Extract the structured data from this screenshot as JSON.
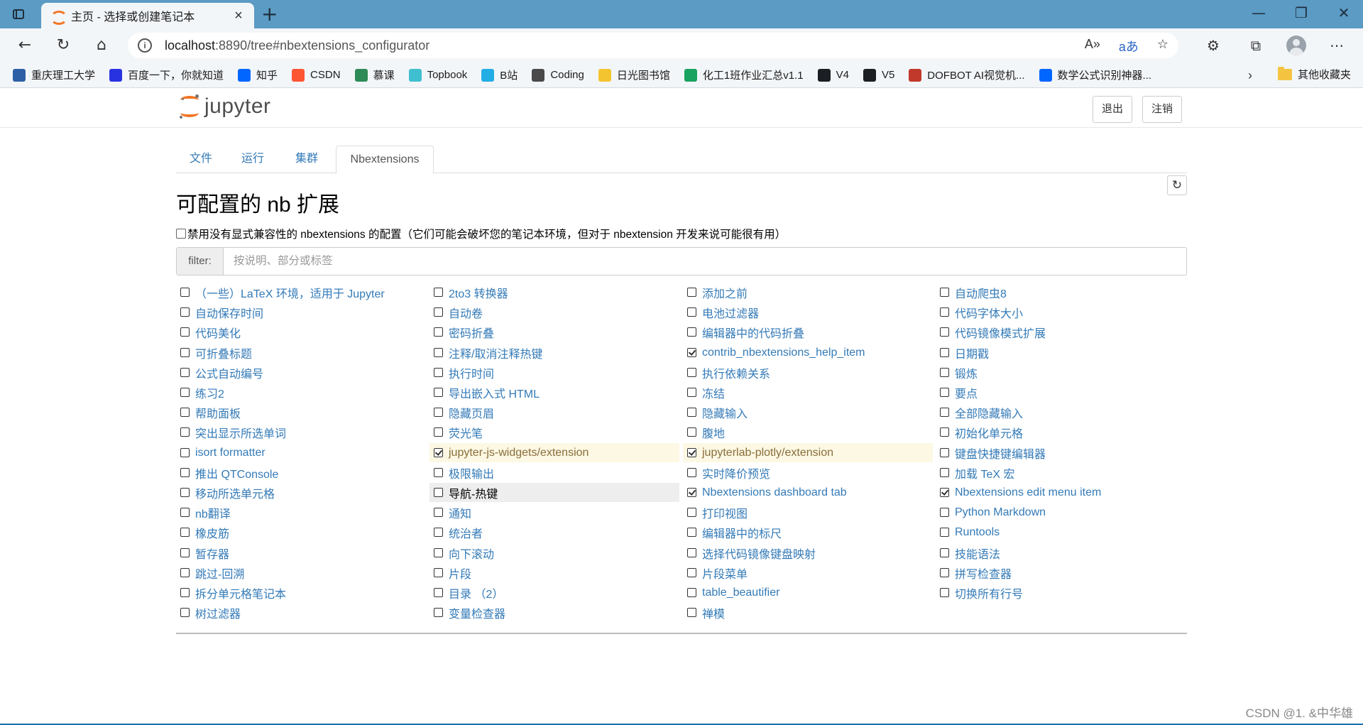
{
  "browser": {
    "tab_title": "主页 - 选择或创建笔记本",
    "url_host": "localhost",
    "url_rest": ":8890/tree#nbextensions_configurator",
    "bookmarks": [
      {
        "label": "重庆理工大学",
        "icon": "globe-icon",
        "color": "#2d5fa6"
      },
      {
        "label": "百度一下，你就知道",
        "icon": "baidu-paw-icon",
        "color": "#2932e1"
      },
      {
        "label": "知乎",
        "icon": "zhihu-icon",
        "color": "#0066ff"
      },
      {
        "label": "CSDN",
        "icon": "csdn-icon",
        "color": "#fc5531"
      },
      {
        "label": "慕课",
        "icon": "mooc-icon",
        "color": "#2e8b57"
      },
      {
        "label": "Topbook",
        "icon": "topbook-icon",
        "color": "#3fbfd0"
      },
      {
        "label": "B站",
        "icon": "bilibili-icon",
        "color": "#23ade5"
      },
      {
        "label": "Coding",
        "icon": "coding-icon",
        "color": "#4a4a4a"
      },
      {
        "label": "日光图书馆",
        "icon": "sun-icon",
        "color": "#f4c430"
      },
      {
        "label": "化工1班作业汇总v1.1",
        "icon": "sheet-icon",
        "color": "#1aa260"
      },
      {
        "label": "V4",
        "icon": "github-icon",
        "color": "#1b1f23"
      },
      {
        "label": "V5",
        "icon": "github-icon",
        "color": "#1b1f23"
      },
      {
        "label": "DOFBOT AI视觉机...",
        "icon": "robot-icon",
        "color": "#c0392b"
      },
      {
        "label": "数学公式识别神器...",
        "icon": "zhihu-icon",
        "color": "#0066ff"
      }
    ],
    "other_bookmarks": "其他收藏夹"
  },
  "header": {
    "logo_text": "jupyter",
    "quit_label": "退出",
    "logout_label": "注销"
  },
  "tabs": [
    "文件",
    "运行",
    "集群",
    "Nbextensions"
  ],
  "page": {
    "title": "可配置的 nb 扩展",
    "compat_label": "禁用没有显式兼容性的 nbextensions 的配置（它们可能会破坏您的笔记本环境，但对于 nbextension 开发来说可能很有用）",
    "filter_label": "filter:",
    "filter_placeholder": "按说明、部分或标签"
  },
  "extensions": {
    "col1": [
      {
        "label": "（一些）LaTeX 环境，适用于 Jupyter",
        "checked": false
      },
      {
        "label": "自动保存时间",
        "checked": false
      },
      {
        "label": "代码美化",
        "checked": false
      },
      {
        "label": "可折叠标题",
        "checked": false
      },
      {
        "label": "公式自动编号",
        "checked": false
      },
      {
        "label": "练习2",
        "checked": false
      },
      {
        "label": "帮助面板",
        "checked": false
      },
      {
        "label": "突出显示所选单词",
        "checked": false
      },
      {
        "label": "isort formatter",
        "checked": false
      },
      {
        "label": "推出 QTConsole",
        "checked": false
      },
      {
        "label": "移动所选单元格",
        "checked": false
      },
      {
        "label": "nb翻译",
        "checked": false
      },
      {
        "label": "橡皮筋",
        "checked": false
      },
      {
        "label": "暂存器",
        "checked": false
      },
      {
        "label": "跳过-回溯",
        "checked": false
      },
      {
        "label": "拆分单元格笔记本",
        "checked": false
      },
      {
        "label": "树过滤器",
        "checked": false
      }
    ],
    "col2": [
      {
        "label": "2to3 转换器",
        "checked": false
      },
      {
        "label": "自动卷",
        "checked": false
      },
      {
        "label": "密码折叠",
        "checked": false
      },
      {
        "label": "注释/取消注释热键",
        "checked": false
      },
      {
        "label": "执行时间",
        "checked": false
      },
      {
        "label": "导出嵌入式 HTML",
        "checked": false
      },
      {
        "label": "隐藏页眉",
        "checked": false
      },
      {
        "label": "荧光笔",
        "checked": false
      },
      {
        "label": "jupyter-js-widgets/extension",
        "checked": true,
        "state": "highlight"
      },
      {
        "label": "极限输出",
        "checked": false
      },
      {
        "label": "导航-热键",
        "checked": false,
        "state": "selected"
      },
      {
        "label": "通知",
        "checked": false
      },
      {
        "label": "统治者",
        "checked": false
      },
      {
        "label": "向下滚动",
        "checked": false
      },
      {
        "label": "片段",
        "checked": false
      },
      {
        "label": "目录 （2）",
        "checked": false
      },
      {
        "label": "变量检查器",
        "checked": false
      }
    ],
    "col3": [
      {
        "label": "添加之前",
        "checked": false
      },
      {
        "label": "电池过滤器",
        "checked": false
      },
      {
        "label": "编辑器中的代码折叠",
        "checked": false
      },
      {
        "label": "contrib_nbextensions_help_item",
        "checked": true
      },
      {
        "label": "执行依赖关系",
        "checked": false
      },
      {
        "label": "冻结",
        "checked": false
      },
      {
        "label": "隐藏输入",
        "checked": false
      },
      {
        "label": "腹地",
        "checked": false
      },
      {
        "label": "jupyterlab-plotly/extension",
        "checked": true,
        "state": "highlight"
      },
      {
        "label": "实时降价预览",
        "checked": false
      },
      {
        "label": "Nbextensions dashboard tab",
        "checked": true
      },
      {
        "label": "打印视图",
        "checked": false
      },
      {
        "label": "编辑器中的标尺",
        "checked": false
      },
      {
        "label": "选择代码镜像键盘映射",
        "checked": false
      },
      {
        "label": "片段菜单",
        "checked": false
      },
      {
        "label": "table_beautifier",
        "checked": false
      },
      {
        "label": "禅模",
        "checked": false
      }
    ],
    "col4": [
      {
        "label": "自动爬虫8",
        "checked": false
      },
      {
        "label": "代码字体大小",
        "checked": false
      },
      {
        "label": "代码镜像模式扩展",
        "checked": false
      },
      {
        "label": "日期戳",
        "checked": false
      },
      {
        "label": "锻炼",
        "checked": false
      },
      {
        "label": "要点",
        "checked": false
      },
      {
        "label": "全部隐藏输入",
        "checked": false
      },
      {
        "label": "初始化单元格",
        "checked": false
      },
      {
        "label": "键盘快捷键编辑器",
        "checked": false
      },
      {
        "label": "加载 TeX 宏",
        "checked": false
      },
      {
        "label": "Nbextensions edit menu item",
        "checked": true
      },
      {
        "label": "Python Markdown",
        "checked": false
      },
      {
        "label": "Runtools",
        "checked": false
      },
      {
        "label": "技能语法",
        "checked": false
      },
      {
        "label": "拼写检查器",
        "checked": false
      },
      {
        "label": "切换所有行号",
        "checked": false
      }
    ]
  },
  "watermark": "CSDN @1. &中华雄"
}
